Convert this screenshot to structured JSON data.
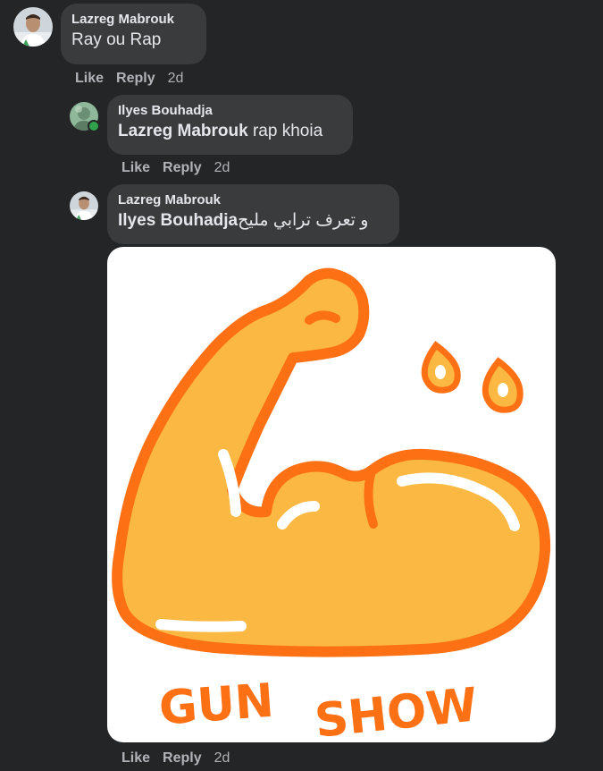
{
  "comments": [
    {
      "author": "Lazreg Mabrouk",
      "text": "Ray ou Rap",
      "like": "Like",
      "reply": "Reply",
      "time": "2d"
    },
    {
      "author": "Ilyes Bouhadja",
      "mention": "Lazreg Mabrouk",
      "text": " rap khoia",
      "like": "Like",
      "reply": "Reply",
      "time": "2d"
    },
    {
      "author": "Lazreg Mabrouk",
      "mention": "Ilyes Bouhadja",
      "text": " و تعرف ترابي مليح",
      "like": "Like",
      "reply": "Reply",
      "time": "2d"
    }
  ],
  "sticker": {
    "caption_left": "GUN",
    "caption_right": "SHOW"
  },
  "colors": {
    "background": "#242526",
    "bubble": "#3a3b3c",
    "text": "#e4e6eb",
    "muted": "#b0b3b8",
    "online": "#31a24c",
    "sticker_orange": "#fd7014",
    "sticker_fill": "#fbb944"
  }
}
